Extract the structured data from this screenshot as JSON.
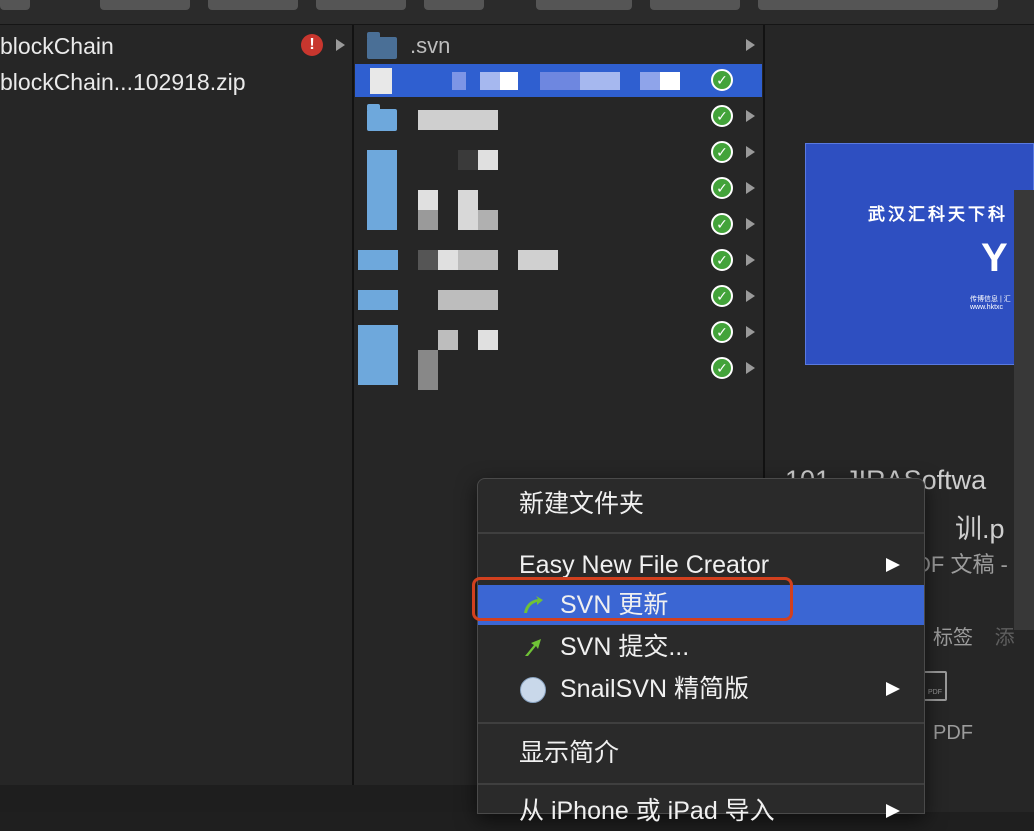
{
  "window": {
    "title": ""
  },
  "column1": {
    "items": [
      {
        "name": "blockChain",
        "warning": "!"
      },
      {
        "name": "blockChain...102918.zip"
      }
    ]
  },
  "column2": {
    "items": [
      {
        "name": ".svn"
      }
    ]
  },
  "preview": {
    "cover_title": "武汉汇科天下科",
    "cover_small1": "传博信息 | 汇",
    "cover_small2": "www.hktxc",
    "file_name_line1": "101_JIRASoftwa",
    "file_name_line2": "训.p",
    "file_kind": "DF 文稿 -",
    "tags_label": "标签",
    "tags_extra": "添",
    "pdf_label": "PDF"
  },
  "context_menu": {
    "items": [
      {
        "label": "新建文件夹"
      },
      {
        "label": "Easy New File Creator",
        "submenu": true
      },
      {
        "label": "SVN 更新",
        "icon": "svn-update-icon",
        "selected": true
      },
      {
        "label": "SVN 提交...",
        "icon": "svn-commit-icon"
      },
      {
        "label": "SnailSVN 精简版",
        "icon": "snailsvn-icon",
        "submenu": true
      },
      {
        "label": "显示简介"
      },
      {
        "label": "从 iPhone 或 iPad 导入",
        "submenu": true
      }
    ]
  },
  "colors": {
    "selection": "#3b66d3",
    "highlight_border": "#d2401e",
    "check": "#43a33a"
  }
}
